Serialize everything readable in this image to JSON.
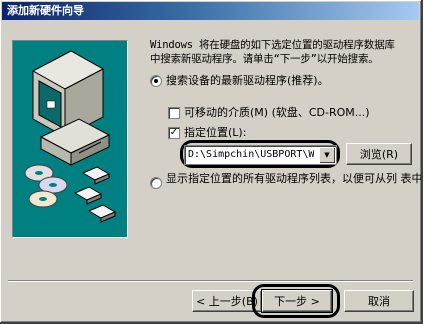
{
  "window": {
    "title": "添加新硬件向导"
  },
  "description": "Windows 将在硬盘的如下选定位置的驱动程序数据库\n中搜索新驱动程序。请单击“下一步”以开始搜索。",
  "options": {
    "search_best": {
      "label": "搜索设备的最新驱动程序(推荐)。",
      "selected": true
    },
    "removable": {
      "label": "可移动的介质(M) (软盘、CD-ROM...)",
      "checked": false
    },
    "specify_location": {
      "label": "指定位置(L):",
      "checked": true
    },
    "location_value": "D:\\Simpchin\\USBPORT\\W",
    "browse_label": "浏览(R)",
    "display_list": {
      "label": "显示指定位置的所有驱动程序列表，以便可从列\n表中选择所需的驱动程序(D)",
      "selected": false
    }
  },
  "buttons": {
    "back": "< 上一步(B)",
    "next": "下一步 >",
    "cancel": "取消"
  },
  "icons": {
    "computer": "computer-icon",
    "cds": "cd-disc-icon",
    "floppies": "floppy-disk-icon",
    "dropdown": "chevron-down-icon"
  },
  "colors": {
    "art_bg": "#008080",
    "title_start": "#0a246a",
    "window_bg": "#d4d0c8"
  }
}
